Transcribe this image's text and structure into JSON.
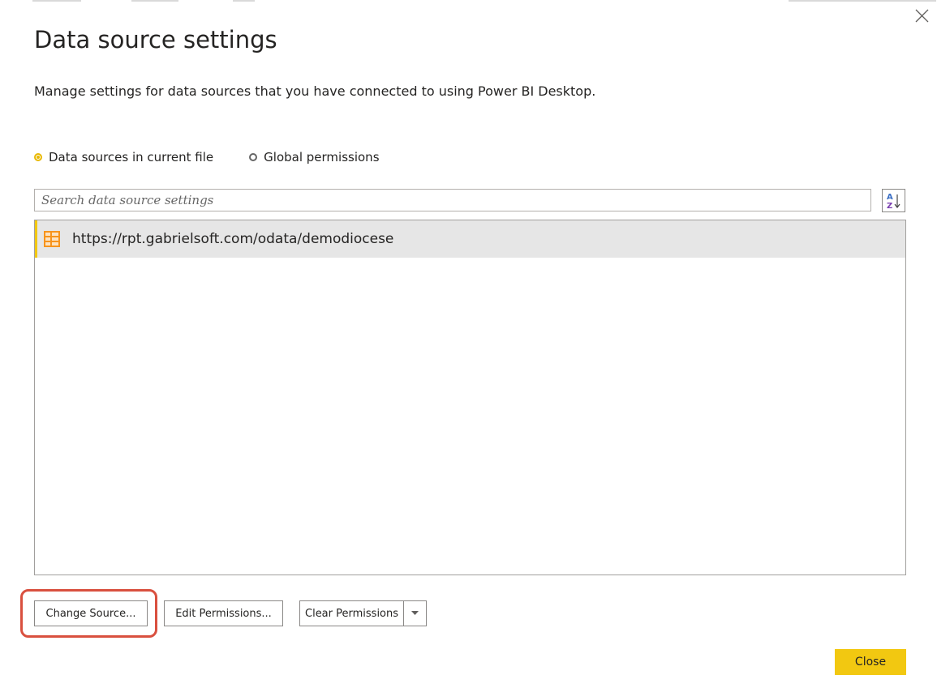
{
  "dialog": {
    "title": "Data source settings",
    "description": "Manage settings for data sources that you have connected to using Power BI Desktop."
  },
  "scope": {
    "options": [
      {
        "label": "Data sources in current file",
        "selected": true
      },
      {
        "label": "Global permissions",
        "selected": false
      }
    ]
  },
  "search": {
    "placeholder": "Search data source settings",
    "value": ""
  },
  "sort": {
    "icon": "sort-az-icon"
  },
  "data_sources": [
    {
      "label": "https://rpt.gabrielsoft.com/odata/demodiocese",
      "icon": "table-icon",
      "selected": true
    }
  ],
  "buttons": {
    "change_source": "Change Source...",
    "edit_permissions": "Edit Permissions...",
    "clear_permissions": "Clear Permissions",
    "close": "Close"
  },
  "colors": {
    "accent": "#f2c811",
    "highlight": "#d9503f",
    "selected_row": "#e6e6e6"
  }
}
